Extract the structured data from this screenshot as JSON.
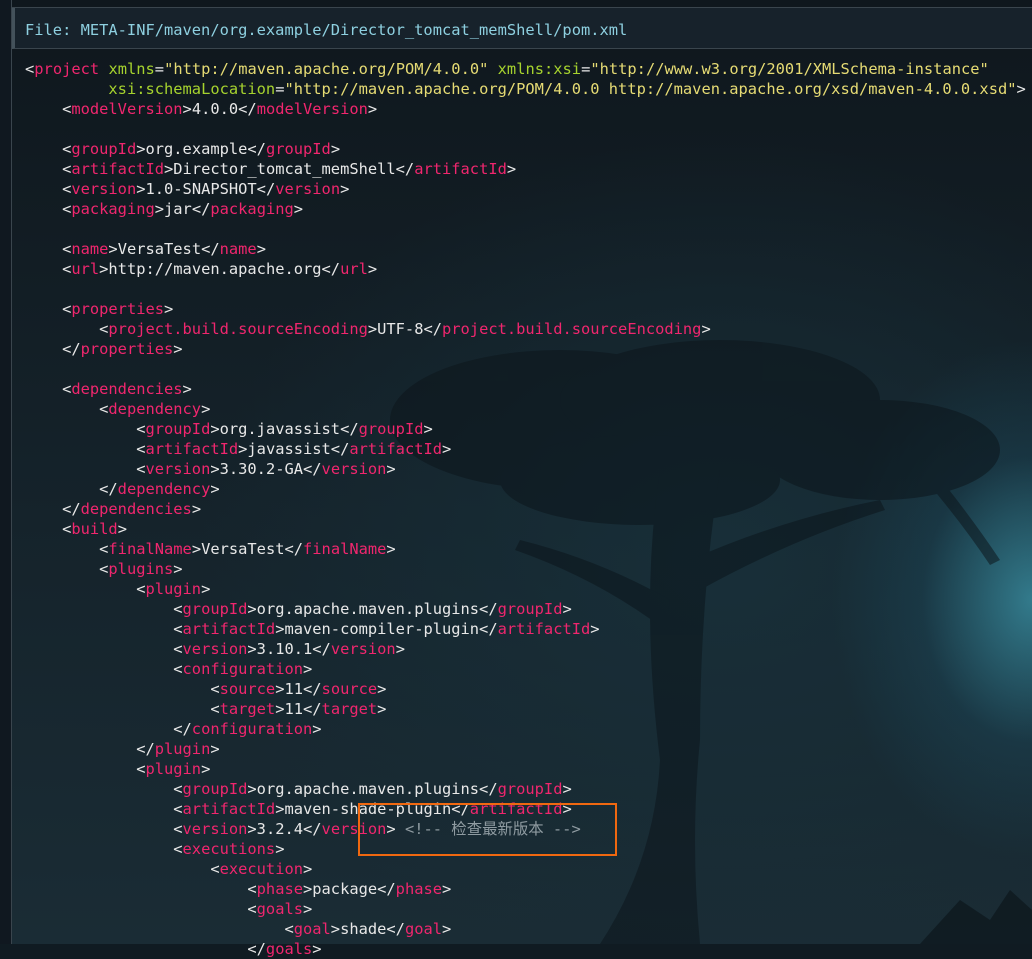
{
  "header": {
    "file_label": "File: META-INF/maven/org.example/Director_tomcat_memShell/pom.xml"
  },
  "code_lines": [
    [
      [
        "p",
        "<"
      ],
      [
        "t",
        "project"
      ],
      [
        "p",
        " "
      ],
      [
        "a",
        "xmlns"
      ],
      [
        "p",
        "="
      ],
      [
        "s",
        "\"http://maven.apache.org/POM/4.0.0\""
      ],
      [
        "p",
        " "
      ],
      [
        "a",
        "xmlns:xsi"
      ],
      [
        "p",
        "="
      ],
      [
        "s",
        "\"http://www.w3.org/2001/XMLSchema-instance\""
      ]
    ],
    [
      [
        "p",
        "         "
      ],
      [
        "a",
        "xsi:schemaLocation"
      ],
      [
        "p",
        "="
      ],
      [
        "s",
        "\"http://maven.apache.org/POM/4.0.0 http://maven.apache.org/xsd/maven-4.0.0.xsd\""
      ],
      [
        "p",
        ">"
      ]
    ],
    [
      [
        "p",
        "    <"
      ],
      [
        "t",
        "modelVersion"
      ],
      [
        "p",
        ">4.0.0</"
      ],
      [
        "t",
        "modelVersion"
      ],
      [
        "p",
        ">"
      ]
    ],
    [],
    [
      [
        "p",
        "    <"
      ],
      [
        "t",
        "groupId"
      ],
      [
        "p",
        ">org.example</"
      ],
      [
        "t",
        "groupId"
      ],
      [
        "p",
        ">"
      ]
    ],
    [
      [
        "p",
        "    <"
      ],
      [
        "t",
        "artifactId"
      ],
      [
        "p",
        ">Director_tomcat_memShell</"
      ],
      [
        "t",
        "artifactId"
      ],
      [
        "p",
        ">"
      ]
    ],
    [
      [
        "p",
        "    <"
      ],
      [
        "t",
        "version"
      ],
      [
        "p",
        ">1.0-SNAPSHOT</"
      ],
      [
        "t",
        "version"
      ],
      [
        "p",
        ">"
      ]
    ],
    [
      [
        "p",
        "    <"
      ],
      [
        "t",
        "packaging"
      ],
      [
        "p",
        ">jar</"
      ],
      [
        "t",
        "packaging"
      ],
      [
        "p",
        ">"
      ]
    ],
    [],
    [
      [
        "p",
        "    <"
      ],
      [
        "t",
        "name"
      ],
      [
        "p",
        ">VersaTest</"
      ],
      [
        "t",
        "name"
      ],
      [
        "p",
        ">"
      ]
    ],
    [
      [
        "p",
        "    <"
      ],
      [
        "t",
        "url"
      ],
      [
        "p",
        ">http://maven.apache.org</"
      ],
      [
        "t",
        "url"
      ],
      [
        "p",
        ">"
      ]
    ],
    [],
    [
      [
        "p",
        "    <"
      ],
      [
        "t",
        "properties"
      ],
      [
        "p",
        ">"
      ]
    ],
    [
      [
        "p",
        "        <"
      ],
      [
        "t",
        "project.build.sourceEncoding"
      ],
      [
        "p",
        ">UTF-8</"
      ],
      [
        "t",
        "project.build.sourceEncoding"
      ],
      [
        "p",
        ">"
      ]
    ],
    [
      [
        "p",
        "    </"
      ],
      [
        "t",
        "properties"
      ],
      [
        "p",
        ">"
      ]
    ],
    [],
    [
      [
        "p",
        "    <"
      ],
      [
        "t",
        "dependencies"
      ],
      [
        "p",
        ">"
      ]
    ],
    [
      [
        "p",
        "        <"
      ],
      [
        "t",
        "dependency"
      ],
      [
        "p",
        ">"
      ]
    ],
    [
      [
        "p",
        "            <"
      ],
      [
        "t",
        "groupId"
      ],
      [
        "p",
        ">org.javassist</"
      ],
      [
        "t",
        "groupId"
      ],
      [
        "p",
        ">"
      ]
    ],
    [
      [
        "p",
        "            <"
      ],
      [
        "t",
        "artifactId"
      ],
      [
        "p",
        ">javassist</"
      ],
      [
        "t",
        "artifactId"
      ],
      [
        "p",
        ">"
      ]
    ],
    [
      [
        "p",
        "            <"
      ],
      [
        "t",
        "version"
      ],
      [
        "p",
        ">3.30.2-GA</"
      ],
      [
        "t",
        "version"
      ],
      [
        "p",
        ">"
      ]
    ],
    [
      [
        "p",
        "        </"
      ],
      [
        "t",
        "dependency"
      ],
      [
        "p",
        ">"
      ]
    ],
    [
      [
        "p",
        "    </"
      ],
      [
        "t",
        "dependencies"
      ],
      [
        "p",
        ">"
      ]
    ],
    [
      [
        "p",
        "    <"
      ],
      [
        "t",
        "build"
      ],
      [
        "p",
        ">"
      ]
    ],
    [
      [
        "p",
        "        <"
      ],
      [
        "t",
        "finalName"
      ],
      [
        "p",
        ">VersaTest</"
      ],
      [
        "t",
        "finalName"
      ],
      [
        "p",
        ">"
      ]
    ],
    [
      [
        "p",
        "        <"
      ],
      [
        "t",
        "plugins"
      ],
      [
        "p",
        ">"
      ]
    ],
    [
      [
        "p",
        "            <"
      ],
      [
        "t",
        "plugin"
      ],
      [
        "p",
        ">"
      ]
    ],
    [
      [
        "p",
        "                <"
      ],
      [
        "t",
        "groupId"
      ],
      [
        "p",
        ">org.apache.maven.plugins</"
      ],
      [
        "t",
        "groupId"
      ],
      [
        "p",
        ">"
      ]
    ],
    [
      [
        "p",
        "                <"
      ],
      [
        "t",
        "artifactId"
      ],
      [
        "p",
        ">maven-compiler-plugin</"
      ],
      [
        "t",
        "artifactId"
      ],
      [
        "p",
        ">"
      ]
    ],
    [
      [
        "p",
        "                <"
      ],
      [
        "t",
        "version"
      ],
      [
        "p",
        ">3.10.1</"
      ],
      [
        "t",
        "version"
      ],
      [
        "p",
        ">"
      ]
    ],
    [
      [
        "p",
        "                <"
      ],
      [
        "t",
        "configuration"
      ],
      [
        "p",
        ">"
      ]
    ],
    [
      [
        "p",
        "                    <"
      ],
      [
        "t",
        "source"
      ],
      [
        "p",
        ">11</"
      ],
      [
        "t",
        "source"
      ],
      [
        "p",
        ">"
      ]
    ],
    [
      [
        "p",
        "                    <"
      ],
      [
        "t",
        "target"
      ],
      [
        "p",
        ">11</"
      ],
      [
        "t",
        "target"
      ],
      [
        "p",
        ">"
      ]
    ],
    [
      [
        "p",
        "                </"
      ],
      [
        "t",
        "configuration"
      ],
      [
        "p",
        ">"
      ]
    ],
    [
      [
        "p",
        "            </"
      ],
      [
        "t",
        "plugin"
      ],
      [
        "p",
        ">"
      ]
    ],
    [
      [
        "p",
        "            <"
      ],
      [
        "t",
        "plugin"
      ],
      [
        "p",
        ">"
      ]
    ],
    [
      [
        "p",
        "                <"
      ],
      [
        "t",
        "groupId"
      ],
      [
        "p",
        ">org.apache.maven.plugins</"
      ],
      [
        "t",
        "groupId"
      ],
      [
        "p",
        ">"
      ]
    ],
    [
      [
        "p",
        "                <"
      ],
      [
        "t",
        "artifactId"
      ],
      [
        "p",
        ">maven-shade-plugin</"
      ],
      [
        "t",
        "artifactId"
      ],
      [
        "p",
        ">"
      ]
    ],
    [
      [
        "p",
        "                <"
      ],
      [
        "t",
        "version"
      ],
      [
        "p",
        ">3.2.4</"
      ],
      [
        "t",
        "version"
      ],
      [
        "p",
        "> "
      ],
      [
        "c",
        "<!-- 检查最新版本 -->"
      ]
    ],
    [
      [
        "p",
        "                <"
      ],
      [
        "t",
        "executions"
      ],
      [
        "p",
        ">"
      ]
    ],
    [
      [
        "p",
        "                    <"
      ],
      [
        "t",
        "execution"
      ],
      [
        "p",
        ">"
      ]
    ],
    [
      [
        "p",
        "                        <"
      ],
      [
        "t",
        "phase"
      ],
      [
        "p",
        ">package</"
      ],
      [
        "t",
        "phase"
      ],
      [
        "p",
        ">"
      ]
    ],
    [
      [
        "p",
        "                        <"
      ],
      [
        "t",
        "goals"
      ],
      [
        "p",
        ">"
      ]
    ],
    [
      [
        "p",
        "                            <"
      ],
      [
        "t",
        "goal"
      ],
      [
        "p",
        ">shade</"
      ],
      [
        "t",
        "goal"
      ],
      [
        "p",
        ">"
      ]
    ],
    [
      [
        "p",
        "                        </"
      ],
      [
        "t",
        "goals"
      ],
      [
        "p",
        ">"
      ]
    ]
  ],
  "colors": {
    "tag": "#f0266e",
    "attr": "#a6d22e",
    "string": "#e6db74",
    "comment": "#8f9ba1",
    "highlight_box": "#f06810"
  }
}
